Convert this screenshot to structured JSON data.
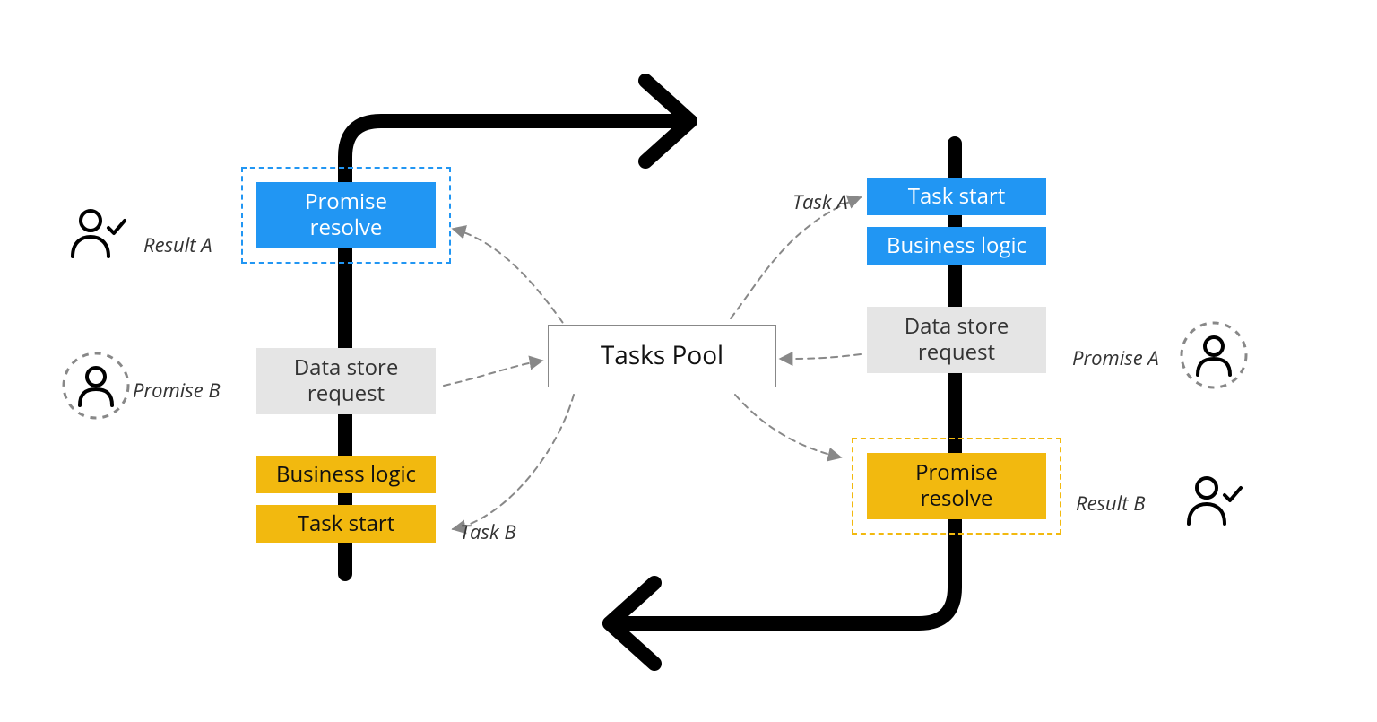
{
  "center": {
    "label": "Tasks Pool"
  },
  "left": {
    "promise_resolve": "Promise\nresolve",
    "data_store_request": "Data store\nrequest",
    "business_logic": "Business logic",
    "task_start": "Task start"
  },
  "right": {
    "task_start": "Task start",
    "business_logic": "Business logic",
    "data_store_request": "Data store\nrequest",
    "promise_resolve": "Promise\nresolve"
  },
  "labels": {
    "result_a": "Result A",
    "promise_b": "Promise B",
    "task_a": "Task A",
    "task_b": "Task B",
    "promise_a": "Promise A",
    "result_b": "Result B"
  },
  "colors": {
    "blue": "#2196f3",
    "yellow": "#f2b90f",
    "grey": "#e5e5e5",
    "dash": "#888"
  }
}
